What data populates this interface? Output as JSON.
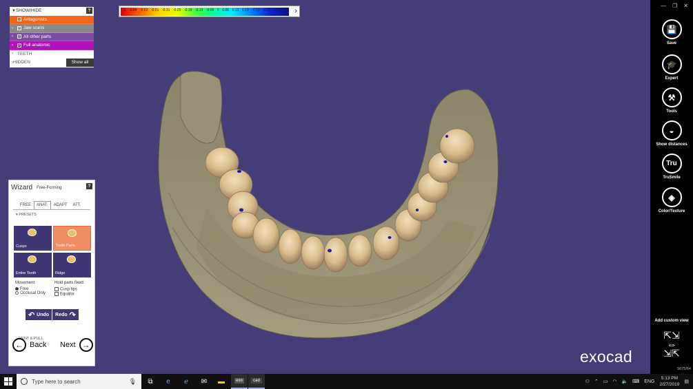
{
  "colorbar": {
    "ticks": [
      "-1",
      "-0.84",
      "-0.63",
      "-0.51",
      "-0.31",
      "-0.25",
      "-0.19",
      "-0.13",
      "-0.06",
      "0",
      "0.06",
      "0.13",
      "0.19",
      "-0.19",
      "-0.12",
      "-0.06",
      "0"
    ],
    "arrow": "›"
  },
  "showhide": {
    "header": "SHOW/HIDE",
    "help": "?",
    "items": [
      {
        "label": "Antagonists",
        "checked": false
      },
      {
        "label": "Jaw scans",
        "checked": true
      },
      {
        "label": "All other parts",
        "checked": true
      },
      {
        "label": "Full anatomic",
        "checked": true
      }
    ],
    "teeth": "TEETH",
    "hidden": "HIDDEN",
    "show_all": "Show all"
  },
  "wizard": {
    "title": "Wizard",
    "subtitle": "Free-Forming",
    "help": "?",
    "tabs": [
      "FREE",
      "ANAT.",
      "ADAPT",
      "ATT."
    ],
    "active_tab": "ANAT.",
    "presets_label": "PRESETS",
    "presets": [
      "Cusps",
      "Tooth Parts",
      "Entire Tooth",
      "Ridge"
    ],
    "movement_label": "Movement:",
    "movement_options": [
      "Free",
      "Occlusal Only"
    ],
    "movement_selected": "Free",
    "hold_label": "Hold parts fixed:",
    "hold_options": [
      "Cusp tips",
      "Equator"
    ],
    "undo": "Undo",
    "redo": "Redo",
    "paint_pull": "PAINT & PULL",
    "back": "Back",
    "next": "Next"
  },
  "toolbar": {
    "save": "Save",
    "expert": "Expert",
    "tools": "Tools",
    "show_distances": "Show distances",
    "trusmile": "TruSmile",
    "trusmile_icon_text": "Tru",
    "color_texture": "Color/Texture",
    "add_custom_view": "Add custom view",
    "version": "5675/64"
  },
  "logo": "exocad",
  "taskbar": {
    "search_placeholder": "Type here to search",
    "app_exo": "exo",
    "app_cad": "cad",
    "lang": "ENG",
    "time": "5:13 PM",
    "date": "2/27/2019"
  },
  "colors": {
    "viewport_bg": "#453d78",
    "antagonists": "#f0661b",
    "full_anatomic": "#b213b9",
    "preset_active": "#f28c63"
  }
}
